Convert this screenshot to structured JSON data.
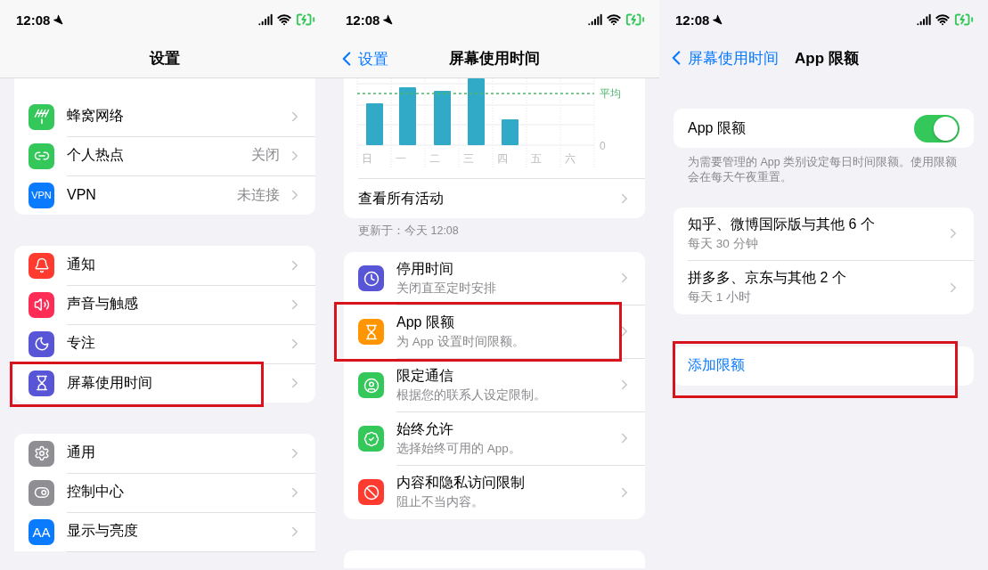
{
  "settings_screen": {
    "status_time": "12:08",
    "title": "设置",
    "groups": [
      {
        "rows": [
          {
            "label": "蜂窝网络",
            "color": "#34c759",
            "highlighted": false
          },
          {
            "label": "个人热点",
            "value": "关闭",
            "color": "#34c759",
            "highlighted": false
          },
          {
            "label": "VPN",
            "value": "未连接",
            "icon_text": "VPN",
            "color": "#0a7aff",
            "highlighted": false
          }
        ]
      },
      {
        "rows": [
          {
            "label": "通知",
            "color": "#ff3b30",
            "highlighted": false
          },
          {
            "label": "声音与触感",
            "color": "#ff2d55",
            "highlighted": false
          },
          {
            "label": "专注",
            "color": "#5856d6",
            "highlighted": false
          },
          {
            "label": "屏幕使用时间",
            "color": "#5856d6",
            "highlighted": true
          }
        ]
      },
      {
        "rows": [
          {
            "label": "通用",
            "color": "#8e8e93",
            "highlighted": false
          },
          {
            "label": "控制中心",
            "color": "#8e8e93",
            "highlighted": false
          },
          {
            "label": "显示与亮度",
            "icon_text": "AA",
            "color": "#0a7aff",
            "highlighted": false
          }
        ]
      }
    ]
  },
  "screen_time_screen": {
    "status_time": "12:08",
    "back_label": "设置",
    "title": "屏幕使用时间",
    "chart": {
      "day_labels": [
        "日",
        "一",
        "二",
        "三",
        "四",
        "五",
        "六"
      ],
      "average_label": "平均",
      "zero_label": "0"
    },
    "all_activity": "查看所有活动",
    "updated": "更新于：今天 12:08",
    "rows": [
      {
        "title": "停用时间",
        "subtitle": "关闭直至定时安排",
        "color": "#5856d6",
        "highlighted": false
      },
      {
        "title": "App 限额",
        "subtitle": "为 App 设置时间限额。",
        "color": "#ff9500",
        "highlighted": true
      },
      {
        "title": "限定通信",
        "subtitle": "根据您的联系人设定限制。",
        "color": "#34c759",
        "highlighted": false
      },
      {
        "title": "始终允许",
        "subtitle": "选择始终可用的 App。",
        "color": "#34c759",
        "highlighted": false
      },
      {
        "title": "内容和隐私访问限制",
        "subtitle": "阻止不当内容。",
        "color": "#ff3b30",
        "highlighted": false
      }
    ]
  },
  "app_limits_screen": {
    "status_time": "12:08",
    "back_label": "屏幕使用时间",
    "title": "App 限额",
    "toggle": {
      "label": "App 限额",
      "on": true
    },
    "toggle_note": "为需要管理的 App 类别设定每日时间限额。使用限额会在每天午夜重置。",
    "limits": [
      {
        "title": "知乎、微博国际版与其他 6 个",
        "subtitle": "每天 30 分钟"
      },
      {
        "title": "拼多多、京东与其他 2 个",
        "subtitle": "每天 1 小时"
      }
    ],
    "add_limit": {
      "label": "添加限额",
      "highlighted": true
    }
  }
}
